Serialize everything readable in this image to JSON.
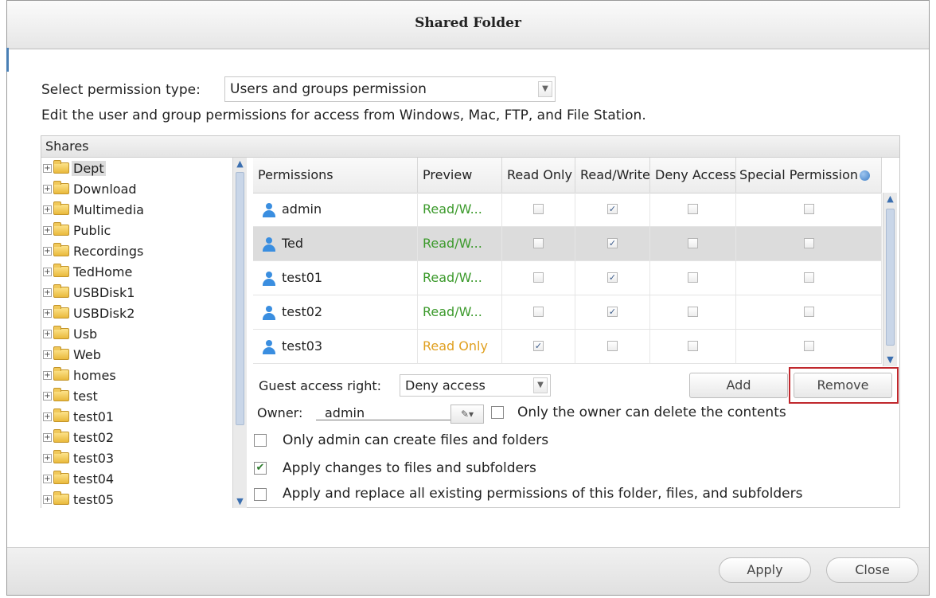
{
  "window": {
    "title": "Shared Folder"
  },
  "permission_type": {
    "label": "Select permission type:",
    "selected": "Users and groups permission",
    "description": "Edit the user and group permissions for access from Windows, Mac, FTP, and File Station."
  },
  "shares": {
    "header": "Shares",
    "items": [
      "Dept",
      "Download",
      "Multimedia",
      "Public",
      "Recordings",
      "TedHome",
      "USBDisk1",
      "USBDisk2",
      "Usb",
      "Web",
      "homes",
      "test",
      "test01",
      "test02",
      "test03",
      "test04",
      "test05"
    ],
    "selected": "Dept"
  },
  "grid": {
    "columns": [
      "Permissions",
      "Preview",
      "Read Only",
      "Read/Write",
      "Deny Access",
      "Special Permission"
    ],
    "rows": [
      {
        "user": "admin",
        "preview": "Read/W...",
        "read_only": false,
        "read_write": true,
        "deny": false,
        "special": false,
        "preview_color": "#3c9a2c"
      },
      {
        "user": "Ted",
        "preview": "Read/W...",
        "read_only": false,
        "read_write": true,
        "deny": false,
        "special": false,
        "preview_color": "#3c9a2c"
      },
      {
        "user": "test01",
        "preview": "Read/W...",
        "read_only": false,
        "read_write": true,
        "deny": false,
        "special": false,
        "preview_color": "#3c9a2c"
      },
      {
        "user": "test02",
        "preview": "Read/W...",
        "read_only": false,
        "read_write": true,
        "deny": false,
        "special": false,
        "preview_color": "#3c9a2c"
      },
      {
        "user": "test03",
        "preview": "Read Only",
        "read_only": true,
        "read_write": false,
        "deny": false,
        "special": false,
        "preview_color": "#e0a020"
      }
    ],
    "selected_row": "Ted"
  },
  "guest": {
    "label": "Guest access right:",
    "selected": "Deny access"
  },
  "buttons": {
    "add": "Add",
    "remove": "Remove",
    "apply": "Apply",
    "close": "Close"
  },
  "owner": {
    "label": "Owner:",
    "value": "admin",
    "only_owner_delete": "Only the owner can delete the contents"
  },
  "options": {
    "only_admin_create": "Only admin can create files and folders",
    "apply_changes": "Apply changes to files and subfolders",
    "apply_replace": "Apply and replace all existing permissions of this folder, files, and subfolders"
  },
  "colors": {
    "accent": "#3a8ee0",
    "highlight": "#c0282d",
    "preview_rw": "#3c9a2c",
    "preview_ro": "#e0a020"
  }
}
